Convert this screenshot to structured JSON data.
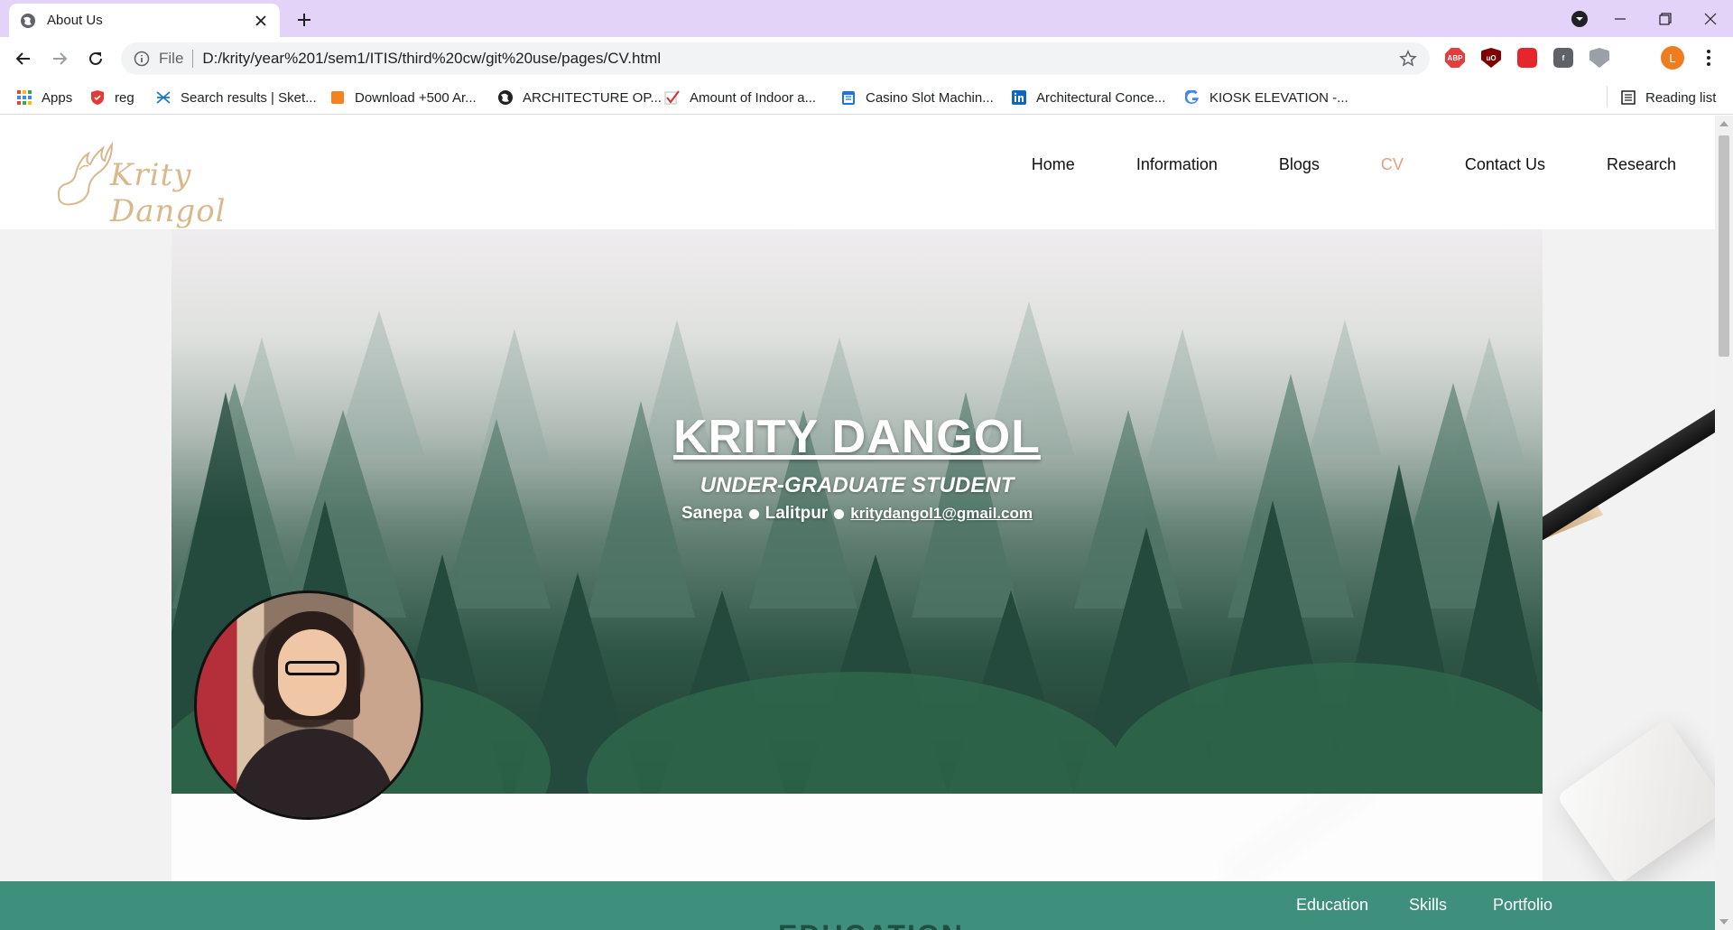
{
  "browser": {
    "tab_title": "About Us",
    "url_scheme": "File",
    "url": "D:/krity/year%201/sem1/ITIS/third%20cw/git%20use/pages/CV.html",
    "profile_initial": "L",
    "accent_color": "#e3d3f8",
    "bookmarks": [
      {
        "label": "Apps",
        "icon": "apps-grid-icon"
      },
      {
        "label": "reg",
        "icon": "shield-red-icon"
      },
      {
        "label": "Search results | Sket...",
        "icon": "sketchfab-icon"
      },
      {
        "label": "Download +500 Ar...",
        "icon": "orange-square-icon"
      },
      {
        "label": "ARCHITECTURE OP...",
        "icon": "globe-icon"
      },
      {
        "label": "Amount of Indoor a...",
        "icon": "checkmark-icon"
      },
      {
        "label": "Casino Slot Machin...",
        "icon": "calendar-icon"
      },
      {
        "label": "Architectural Conce...",
        "icon": "linkedin-icon"
      },
      {
        "label": "KIOSK ELEVATION -...",
        "icon": "google-icon"
      }
    ],
    "reading_list_label": "Reading list",
    "extensions": [
      {
        "name": "adblock-plus-icon",
        "text": "ABP",
        "color": "#e33c3c"
      },
      {
        "name": "ublock-origin-icon",
        "text": "uO",
        "color": "#800000"
      },
      {
        "name": "pdf-extension-icon",
        "text": "",
        "color": "#e5262b"
      },
      {
        "name": "facebook-extension-icon",
        "text": "f",
        "color": "#5f6368"
      },
      {
        "name": "shield-extension-icon",
        "text": "",
        "color": "#9aa0a6"
      },
      {
        "name": "puzzle-extensions-icon",
        "text": "",
        "color": "#3c4043"
      }
    ]
  },
  "site": {
    "logo_text": "Krity Dangol",
    "nav": [
      {
        "label": "Home",
        "active": false
      },
      {
        "label": "Information",
        "active": false
      },
      {
        "label": "Blogs",
        "active": false
      },
      {
        "label": "CV",
        "active": true
      },
      {
        "label": "Contact Us",
        "active": false
      },
      {
        "label": "Research",
        "active": false
      }
    ],
    "active_color": "#e3a07f"
  },
  "hero": {
    "name": "KRITY DANGOL",
    "role": "UNDER-GRADUATE STUDENT",
    "location_1": "Sanepa",
    "location_2": "Lalitpur",
    "email": "kritydangol1@gmail.com"
  },
  "section_nav": {
    "items": [
      "Education",
      "Skills",
      "Portfolio"
    ],
    "color": "#3f8f7d"
  },
  "section_heading": "EDUCATION"
}
